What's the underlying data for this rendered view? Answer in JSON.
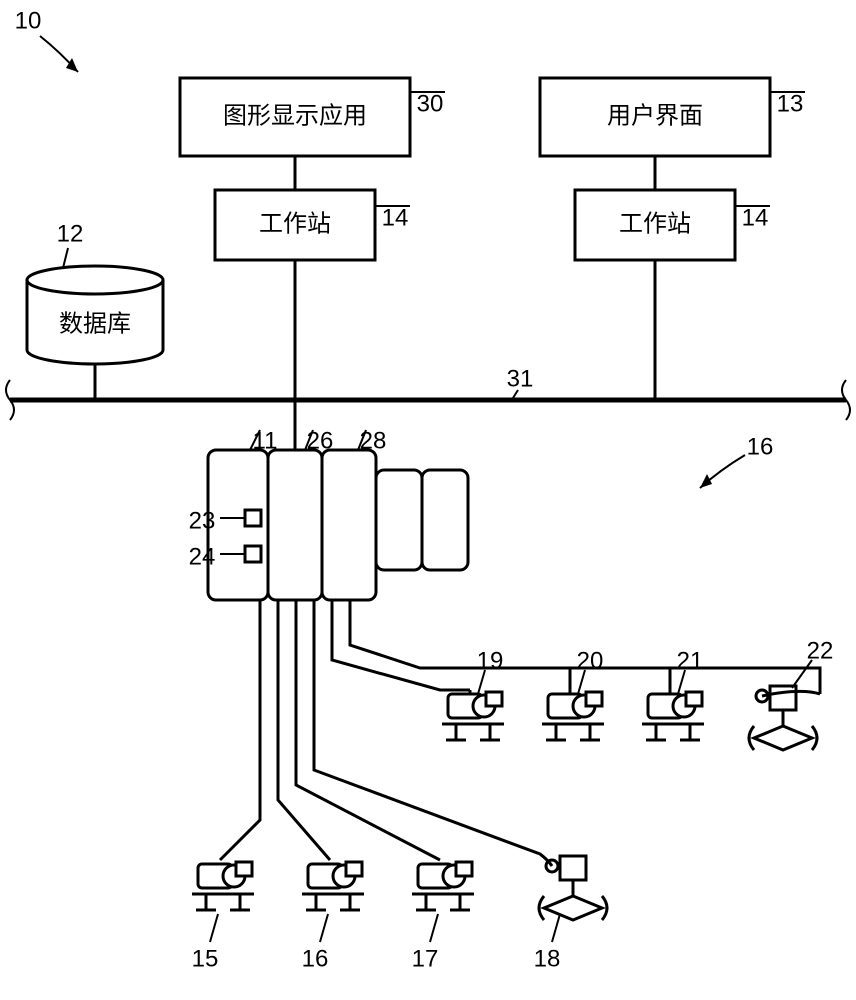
{
  "labels": {
    "graphics_app": "图形显示应用",
    "user_interface": "用户界面",
    "workstation_left": "工作站",
    "workstation_right": "工作站",
    "database": "数据库"
  },
  "ref_nums": {
    "system": "10",
    "db": "12",
    "app_top": "30",
    "ui_top": "13",
    "ws_left": "14",
    "ws_right": "14",
    "bus": "31",
    "area": "16",
    "ctrl_left": "11",
    "ctrl_mid": "26",
    "ctrl_right": "28",
    "port1": "23",
    "port2": "24",
    "dev15": "15",
    "dev16": "16",
    "dev17": "17",
    "dev18": "18",
    "dev19": "19",
    "dev20": "20",
    "dev21": "21",
    "dev22": "22"
  }
}
